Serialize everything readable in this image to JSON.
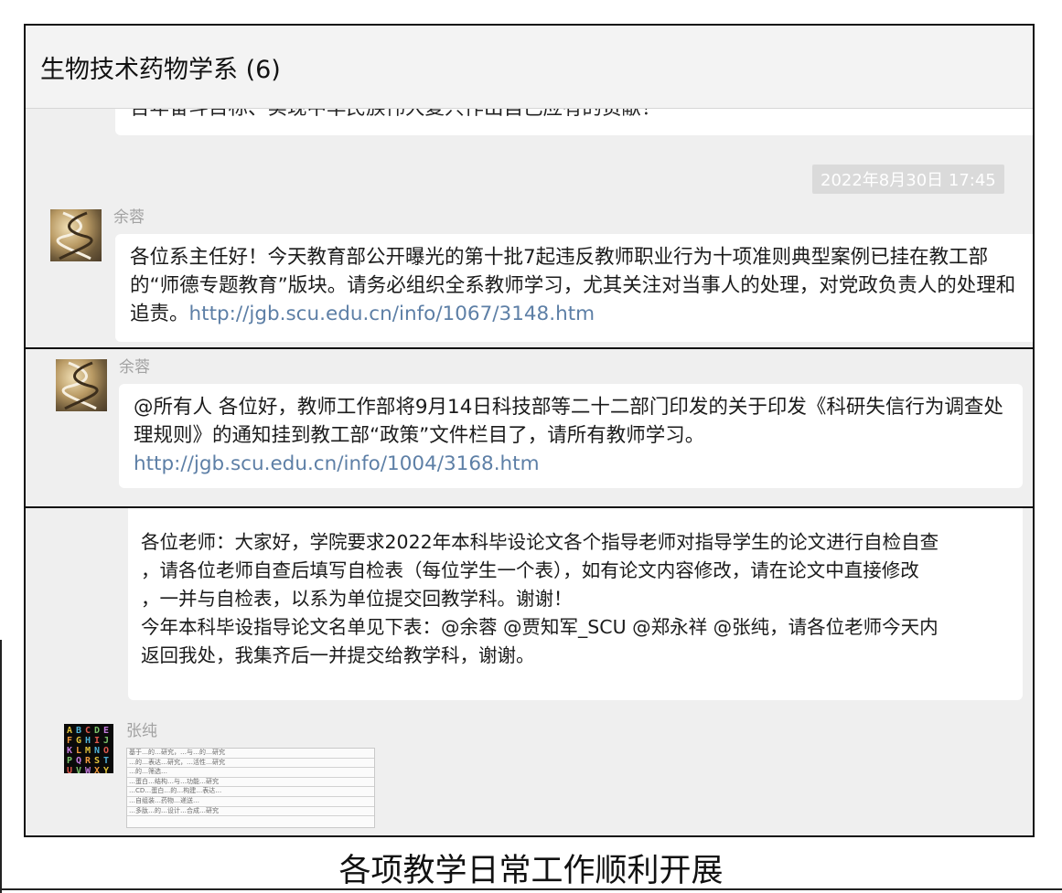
{
  "chat": {
    "title": "生物技术药物学系 (6)"
  },
  "panel1": {
    "clipped_text": "百年奋斗目标、实现中华民族伟大复兴作出自己应有的贡献！",
    "timestamp": "2022年8月30日 17:45",
    "sender": "余蓉",
    "message_text": "各位系主任好！今天教育部公开曝光的第十批7起违反教师职业行为十项准则典型案例已挂在教工部的“师德专题教育”版块。请务必组织全系教师学习，尤其关注对当事人的处理，对党政负责人的处理和追责。",
    "message_link": "http://jgb.scu.edu.cn/info/1067/3148.htm"
  },
  "panel2": {
    "sender": "余蓉",
    "message_text": "@所有人 各位好，教师工作部将9月14日科技部等二十二部门印发的关于印发《科研失信行为调查处理规则》的通知挂到教工部“政策”文件栏目了，请所有教师学习。",
    "message_link": "http://jgb.scu.edu.cn/info/1004/3168.htm"
  },
  "panel3": {
    "message_line1": "各位老师：大家好，学院要求2022年本科毕设论文各个指导老师对指导学生的论文进行自检自查",
    "message_line2": "，请各位老师自查后填写自检表（每位学生一个表），如有论文内容修改，请在论文中直接修改",
    "message_line3": "，一并与自检表，以系为单位提交回教学科。谢谢！",
    "message_line4": "今年本科毕设指导论文名单见下表：@余蓉 @贾知军_SCU @郑永祥 @张纯，请各位老师今天内",
    "message_line5": "返回我处，我集齐后一并提交给教学科，谢谢。",
    "sender": "张纯",
    "avatar_letters": "ABCDEFGHIJKLMNOPQRSTUVWXYZ",
    "table_thumbnail_rows": [
      "基于…的…研究，…与…的…研究",
      "…的…表达…研究，…活性…研究",
      "…的…筛选…",
      "…蛋白…结构…与…功能…研究",
      "…CD…蛋白…的…构建…表达…",
      "…自组装…药物…递送…",
      "…多肽…的…设计…合成…研究"
    ]
  },
  "caption": "各项教学日常工作顺利开展",
  "colors": {
    "link": "#5d7fa6",
    "chat_bg": "#efefef",
    "bubble_bg": "#ffffff",
    "timestamp_bg": "#dadada"
  }
}
